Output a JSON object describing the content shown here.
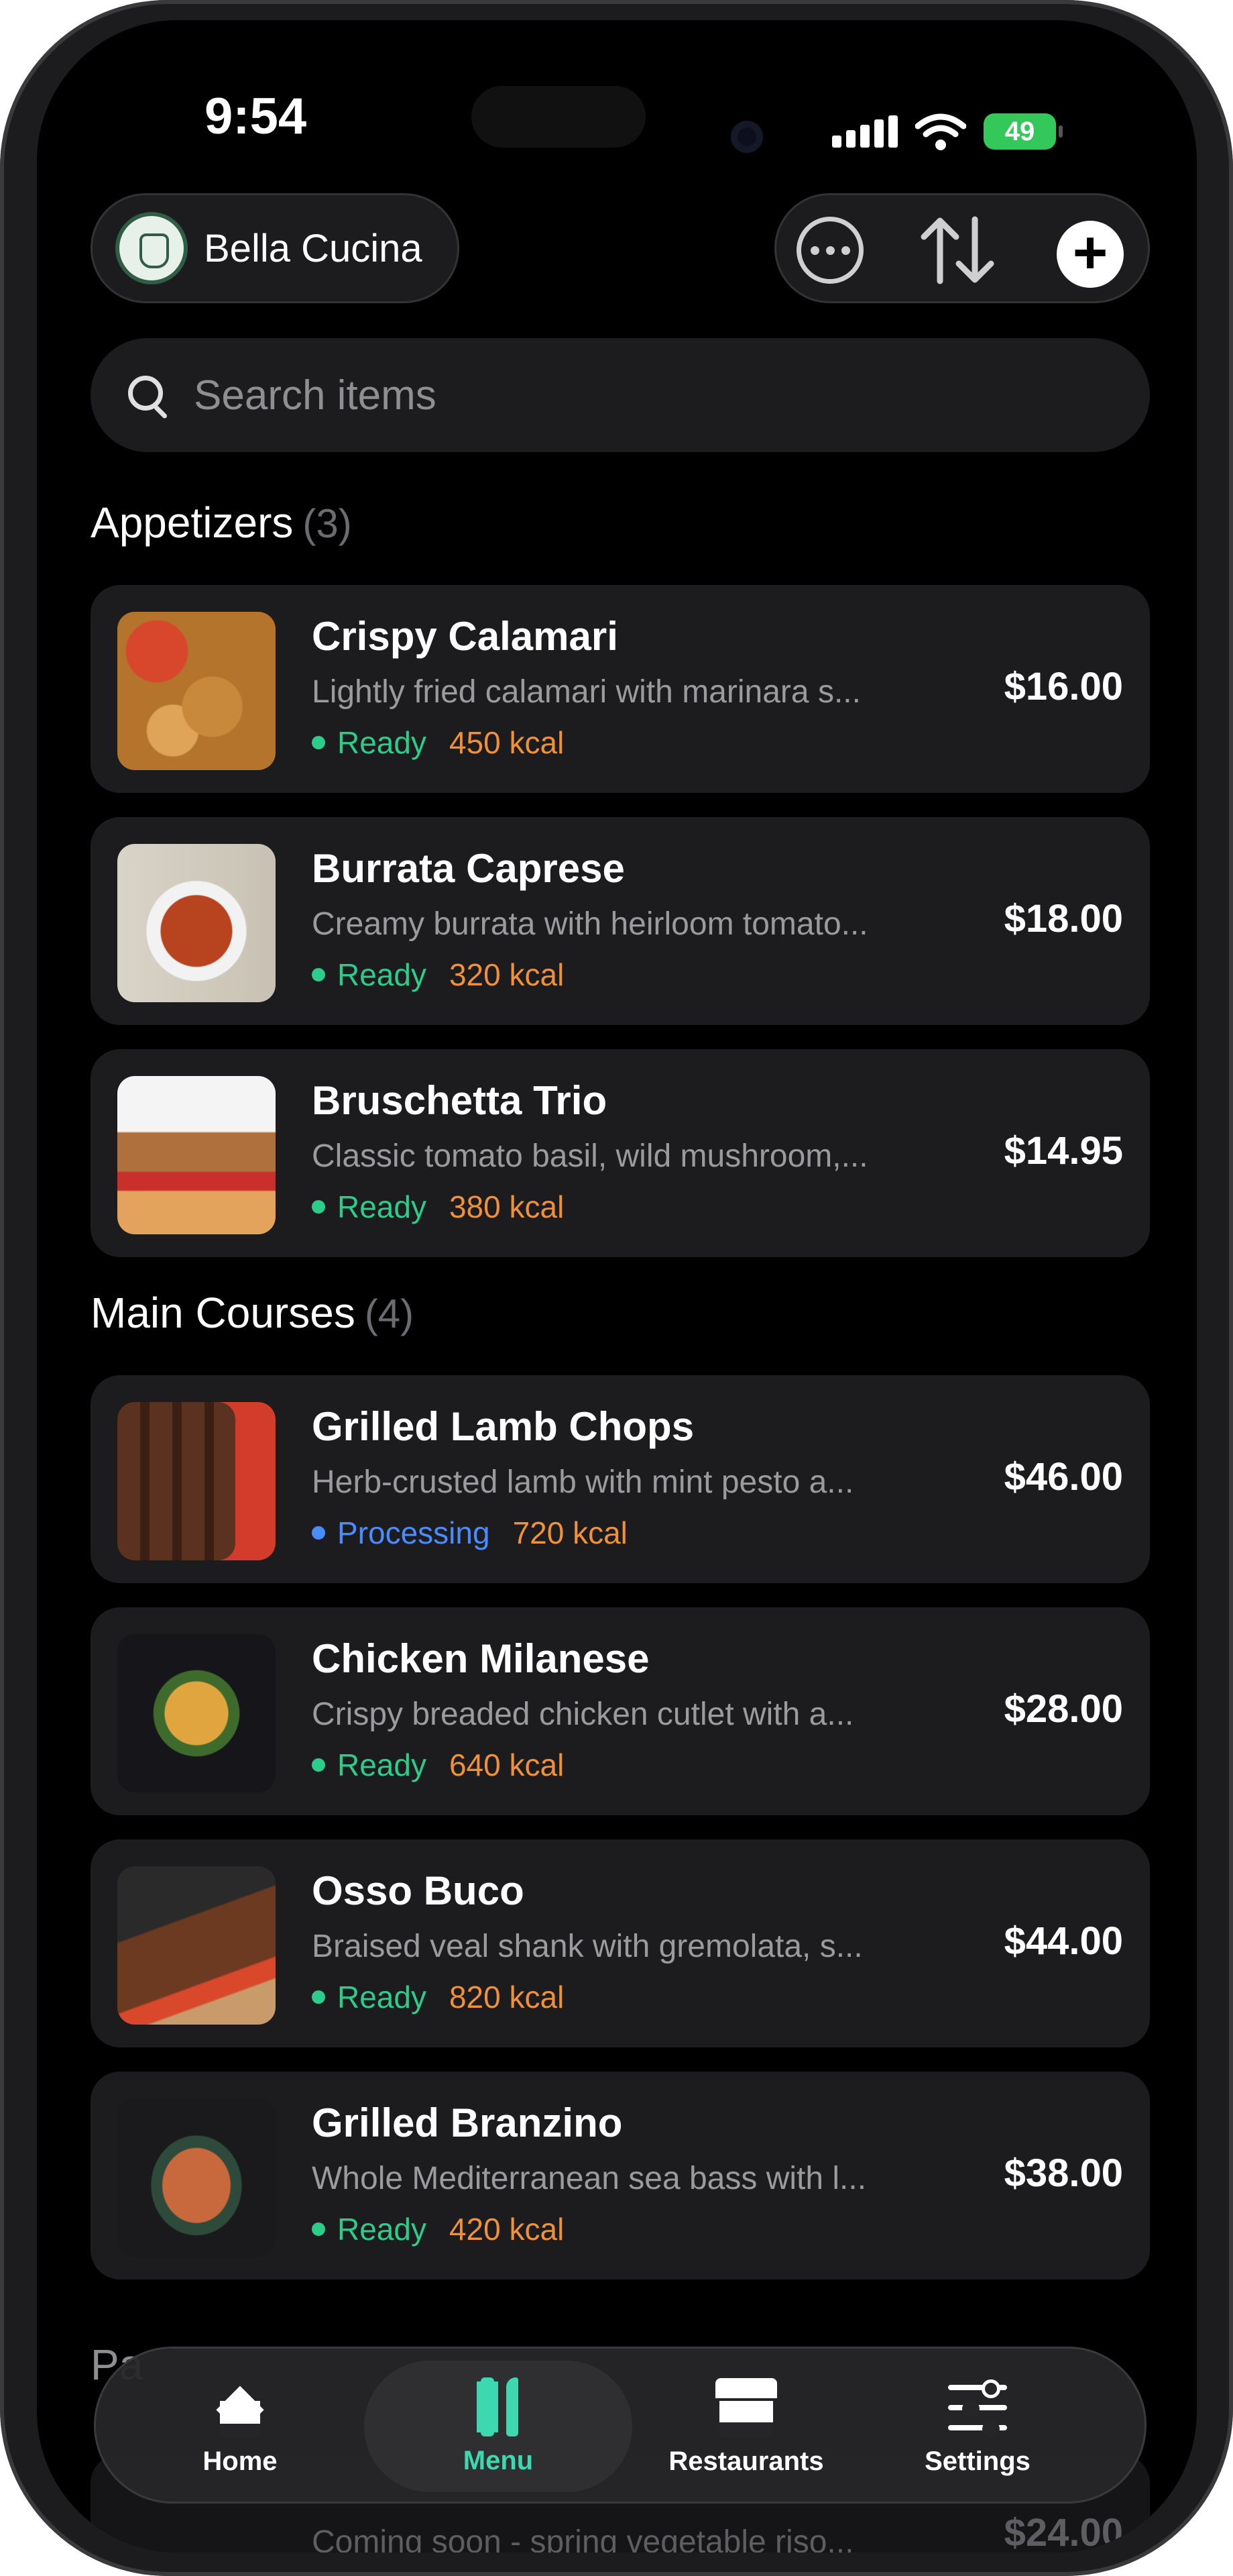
{
  "status_bar": {
    "time": "9:54",
    "battery": "49"
  },
  "header": {
    "restaurant_name": "Bella Cucina"
  },
  "search": {
    "placeholder": "Search items"
  },
  "sections": [
    {
      "title": "Appetizers",
      "count": "(3)",
      "items": [
        {
          "name": "Crispy Calamari",
          "description": "Lightly fried calamari with marinara s...",
          "status": "Ready",
          "kcal": "450 kcal",
          "price": "$16.00"
        },
        {
          "name": "Burrata Caprese",
          "description": "Creamy burrata with heirloom tomato...",
          "status": "Ready",
          "kcal": "320 kcal",
          "price": "$18.00"
        },
        {
          "name": "Bruschetta Trio",
          "description": "Classic tomato basil, wild mushroom,...",
          "status": "Ready",
          "kcal": "380 kcal",
          "price": "$14.95"
        }
      ]
    },
    {
      "title": "Main Courses",
      "count": "(4)",
      "items": [
        {
          "name": "Grilled Lamb Chops",
          "description": "Herb-crusted lamb with mint pesto a...",
          "status": "Processing",
          "kcal": "720 kcal",
          "price": "$46.00"
        },
        {
          "name": "Chicken Milanese",
          "description": "Crispy breaded chicken cutlet with a...",
          "status": "Ready",
          "kcal": "640 kcal",
          "price": "$28.00"
        },
        {
          "name": "Osso Buco",
          "description": "Braised veal shank with gremolata, s...",
          "status": "Ready",
          "kcal": "820 kcal",
          "price": "$44.00"
        },
        {
          "name": "Grilled Branzino",
          "description": "Whole Mediterranean sea bass with l...",
          "status": "Ready",
          "kcal": "420 kcal",
          "price": "$38.00"
        }
      ]
    }
  ],
  "peek": {
    "section_title": "Pa",
    "description": "Coming soon - spring vegetable riso...",
    "price": "$24.00"
  },
  "tabs": {
    "home": "Home",
    "menu": "Menu",
    "restaurants": "Restaurants",
    "settings": "Settings"
  },
  "colors": {
    "ready": "#2ecc8a",
    "processing": "#4a8cff",
    "kcal": "#f0913a",
    "accent": "#3ed8b0"
  }
}
